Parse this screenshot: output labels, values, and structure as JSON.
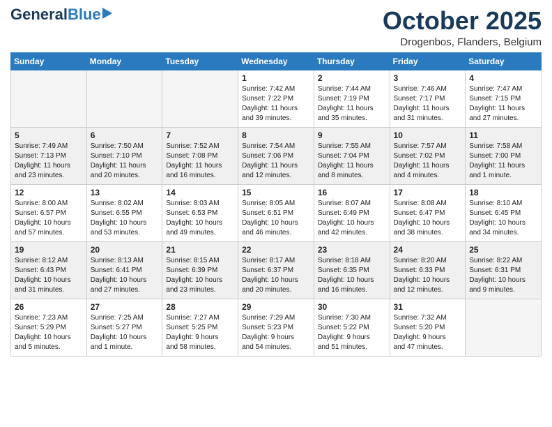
{
  "header": {
    "logo_general": "General",
    "logo_blue": "Blue",
    "month": "October 2025",
    "location": "Drogenbos, Flanders, Belgium"
  },
  "weekdays": [
    "Sunday",
    "Monday",
    "Tuesday",
    "Wednesday",
    "Thursday",
    "Friday",
    "Saturday"
  ],
  "weeks": [
    [
      {
        "day": "",
        "info": ""
      },
      {
        "day": "",
        "info": ""
      },
      {
        "day": "",
        "info": ""
      },
      {
        "day": "1",
        "info": "Sunrise: 7:42 AM\nSunset: 7:22 PM\nDaylight: 11 hours\nand 39 minutes."
      },
      {
        "day": "2",
        "info": "Sunrise: 7:44 AM\nSunset: 7:19 PM\nDaylight: 11 hours\nand 35 minutes."
      },
      {
        "day": "3",
        "info": "Sunrise: 7:46 AM\nSunset: 7:17 PM\nDaylight: 11 hours\nand 31 minutes."
      },
      {
        "day": "4",
        "info": "Sunrise: 7:47 AM\nSunset: 7:15 PM\nDaylight: 11 hours\nand 27 minutes."
      }
    ],
    [
      {
        "day": "5",
        "info": "Sunrise: 7:49 AM\nSunset: 7:13 PM\nDaylight: 11 hours\nand 23 minutes."
      },
      {
        "day": "6",
        "info": "Sunrise: 7:50 AM\nSunset: 7:10 PM\nDaylight: 11 hours\nand 20 minutes."
      },
      {
        "day": "7",
        "info": "Sunrise: 7:52 AM\nSunset: 7:08 PM\nDaylight: 11 hours\nand 16 minutes."
      },
      {
        "day": "8",
        "info": "Sunrise: 7:54 AM\nSunset: 7:06 PM\nDaylight: 11 hours\nand 12 minutes."
      },
      {
        "day": "9",
        "info": "Sunrise: 7:55 AM\nSunset: 7:04 PM\nDaylight: 11 hours\nand 8 minutes."
      },
      {
        "day": "10",
        "info": "Sunrise: 7:57 AM\nSunset: 7:02 PM\nDaylight: 11 hours\nand 4 minutes."
      },
      {
        "day": "11",
        "info": "Sunrise: 7:58 AM\nSunset: 7:00 PM\nDaylight: 11 hours\nand 1 minute."
      }
    ],
    [
      {
        "day": "12",
        "info": "Sunrise: 8:00 AM\nSunset: 6:57 PM\nDaylight: 10 hours\nand 57 minutes."
      },
      {
        "day": "13",
        "info": "Sunrise: 8:02 AM\nSunset: 6:55 PM\nDaylight: 10 hours\nand 53 minutes."
      },
      {
        "day": "14",
        "info": "Sunrise: 8:03 AM\nSunset: 6:53 PM\nDaylight: 10 hours\nand 49 minutes."
      },
      {
        "day": "15",
        "info": "Sunrise: 8:05 AM\nSunset: 6:51 PM\nDaylight: 10 hours\nand 46 minutes."
      },
      {
        "day": "16",
        "info": "Sunrise: 8:07 AM\nSunset: 6:49 PM\nDaylight: 10 hours\nand 42 minutes."
      },
      {
        "day": "17",
        "info": "Sunrise: 8:08 AM\nSunset: 6:47 PM\nDaylight: 10 hours\nand 38 minutes."
      },
      {
        "day": "18",
        "info": "Sunrise: 8:10 AM\nSunset: 6:45 PM\nDaylight: 10 hours\nand 34 minutes."
      }
    ],
    [
      {
        "day": "19",
        "info": "Sunrise: 8:12 AM\nSunset: 6:43 PM\nDaylight: 10 hours\nand 31 minutes."
      },
      {
        "day": "20",
        "info": "Sunrise: 8:13 AM\nSunset: 6:41 PM\nDaylight: 10 hours\nand 27 minutes."
      },
      {
        "day": "21",
        "info": "Sunrise: 8:15 AM\nSunset: 6:39 PM\nDaylight: 10 hours\nand 23 minutes."
      },
      {
        "day": "22",
        "info": "Sunrise: 8:17 AM\nSunset: 6:37 PM\nDaylight: 10 hours\nand 20 minutes."
      },
      {
        "day": "23",
        "info": "Sunrise: 8:18 AM\nSunset: 6:35 PM\nDaylight: 10 hours\nand 16 minutes."
      },
      {
        "day": "24",
        "info": "Sunrise: 8:20 AM\nSunset: 6:33 PM\nDaylight: 10 hours\nand 12 minutes."
      },
      {
        "day": "25",
        "info": "Sunrise: 8:22 AM\nSunset: 6:31 PM\nDaylight: 10 hours\nand 9 minutes."
      }
    ],
    [
      {
        "day": "26",
        "info": "Sunrise: 7:23 AM\nSunset: 5:29 PM\nDaylight: 10 hours\nand 5 minutes."
      },
      {
        "day": "27",
        "info": "Sunrise: 7:25 AM\nSunset: 5:27 PM\nDaylight: 10 hours\nand 1 minute."
      },
      {
        "day": "28",
        "info": "Sunrise: 7:27 AM\nSunset: 5:25 PM\nDaylight: 9 hours\nand 58 minutes."
      },
      {
        "day": "29",
        "info": "Sunrise: 7:29 AM\nSunset: 5:23 PM\nDaylight: 9 hours\nand 54 minutes."
      },
      {
        "day": "30",
        "info": "Sunrise: 7:30 AM\nSunset: 5:22 PM\nDaylight: 9 hours\nand 51 minutes."
      },
      {
        "day": "31",
        "info": "Sunrise: 7:32 AM\nSunset: 5:20 PM\nDaylight: 9 hours\nand 47 minutes."
      },
      {
        "day": "",
        "info": ""
      }
    ]
  ]
}
